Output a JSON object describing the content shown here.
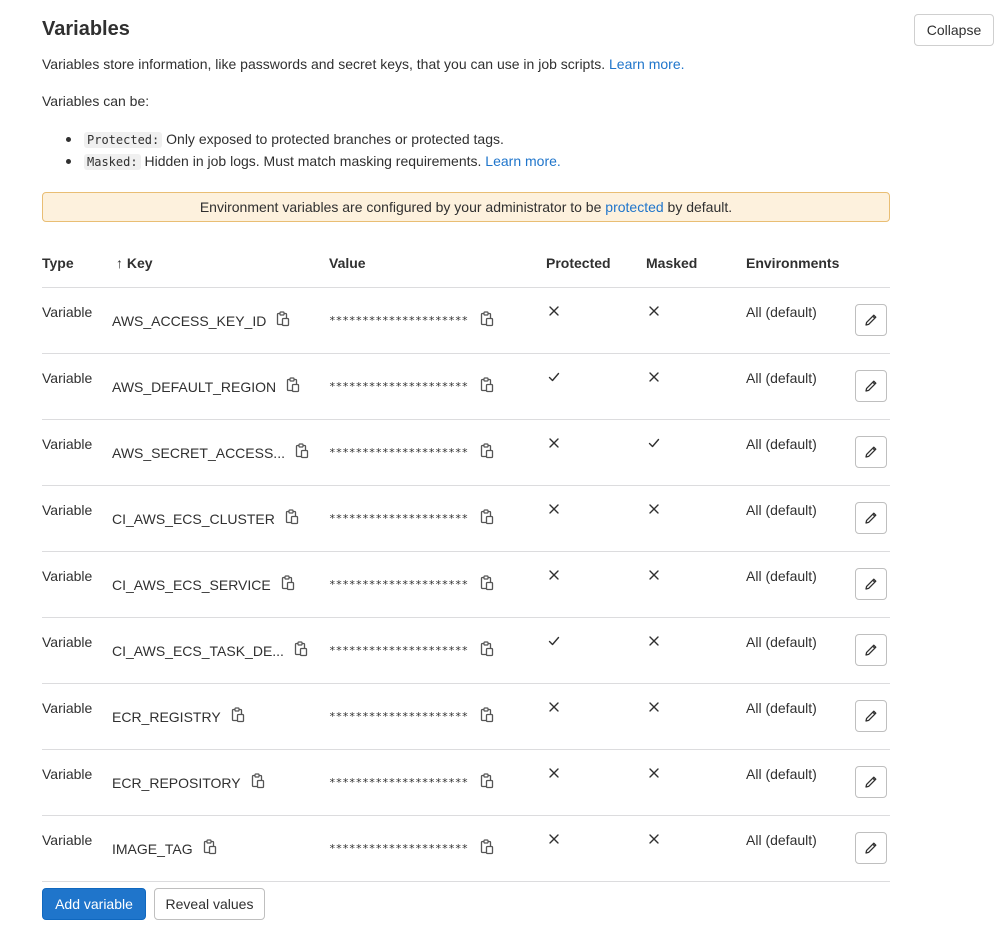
{
  "header": {
    "title": "Variables",
    "collapse_label": "Collapse"
  },
  "description": {
    "text": "Variables store information, like passwords and secret keys, that you can use in job scripts.",
    "link": "Learn more."
  },
  "can_be": "Variables can be:",
  "bullets": [
    {
      "code": "Protected:",
      "text": "Only exposed to protected branches or protected tags.",
      "link": ""
    },
    {
      "code": "Masked:",
      "text": "Hidden in job logs. Must match masking requirements.",
      "link": "Learn more."
    }
  ],
  "alert": {
    "before": "Environment variables are configured by your administrator to be",
    "link": "protected",
    "after": "by default."
  },
  "table": {
    "headers": {
      "type": "Type",
      "key": "↑ Key",
      "value": "Value",
      "protected": "Protected",
      "masked": "Masked",
      "environments": "Environments"
    },
    "rows": [
      {
        "type": "Variable",
        "key": "AWS_ACCESS_KEY_ID",
        "value": "*********************",
        "protected": false,
        "masked": false,
        "environment": "All (default)"
      },
      {
        "type": "Variable",
        "key": "AWS_DEFAULT_REGION",
        "value": "*********************",
        "protected": true,
        "masked": false,
        "environment": "All (default)"
      },
      {
        "type": "Variable",
        "key": "AWS_SECRET_ACCESS...",
        "value": "*********************",
        "protected": false,
        "masked": true,
        "environment": "All (default)"
      },
      {
        "type": "Variable",
        "key": "CI_AWS_ECS_CLUSTER",
        "value": "*********************",
        "protected": false,
        "masked": false,
        "environment": "All (default)"
      },
      {
        "type": "Variable",
        "key": "CI_AWS_ECS_SERVICE",
        "value": "*********************",
        "protected": false,
        "masked": false,
        "environment": "All (default)"
      },
      {
        "type": "Variable",
        "key": "CI_AWS_ECS_TASK_DE...",
        "value": "*********************",
        "protected": true,
        "masked": false,
        "environment": "All (default)"
      },
      {
        "type": "Variable",
        "key": "ECR_REGISTRY",
        "value": "*********************",
        "protected": false,
        "masked": false,
        "environment": "All (default)"
      },
      {
        "type": "Variable",
        "key": "ECR_REPOSITORY",
        "value": "*********************",
        "protected": false,
        "masked": false,
        "environment": "All (default)"
      },
      {
        "type": "Variable",
        "key": "IMAGE_TAG",
        "value": "*********************",
        "protected": false,
        "masked": false,
        "environment": "All (default)"
      }
    ]
  },
  "icons": {
    "copy": "copy-to-clipboard-icon",
    "edit": "pencil-icon",
    "true": "check-icon",
    "false": "close-icon"
  },
  "footer": {
    "add_label": "Add variable",
    "reveal_label": "Reveal values"
  },
  "colors": {
    "link": "#1f75cb",
    "primary": "#1f75cb",
    "alert_bg": "#fdf1dd",
    "alert_border": "#e9be74"
  }
}
